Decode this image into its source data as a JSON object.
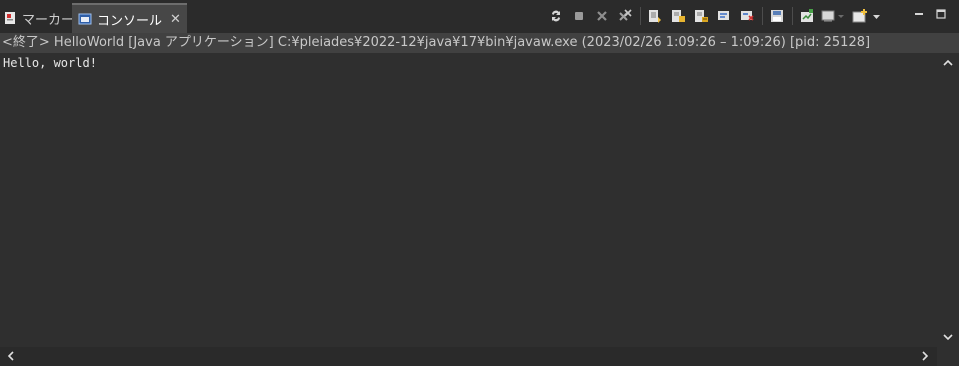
{
  "tabs": {
    "markers_label": "マーカー",
    "console_label": "コンソール",
    "close_glyph": "✕"
  },
  "info": {
    "text": "<終了> HelloWorld [Java アプリケーション] C:¥pleiades¥2022-12¥java¥17¥bin¥javaw.exe  (2023/02/26 1:09:26 – 1:09:26) [pid: 25128]"
  },
  "console": {
    "output": "Hello, world!"
  },
  "toolbar_icons": [
    "relaunch-icon",
    "terminate-icon",
    "remove-launch-icon",
    "remove-all-terminated-icon",
    "scroll-lock-icon",
    "word-wrap-icon",
    "show-on-stdout-icon",
    "show-on-stderr-icon",
    "pin-console-icon",
    "display-selected-console-icon",
    "new-console-view-icon",
    "minimize-icon",
    "maximize-icon"
  ],
  "colors": {
    "background": "#2f2f2f",
    "tabbar": "#2b2b2b",
    "active_tab": "#474747",
    "infobar": "#414141"
  }
}
